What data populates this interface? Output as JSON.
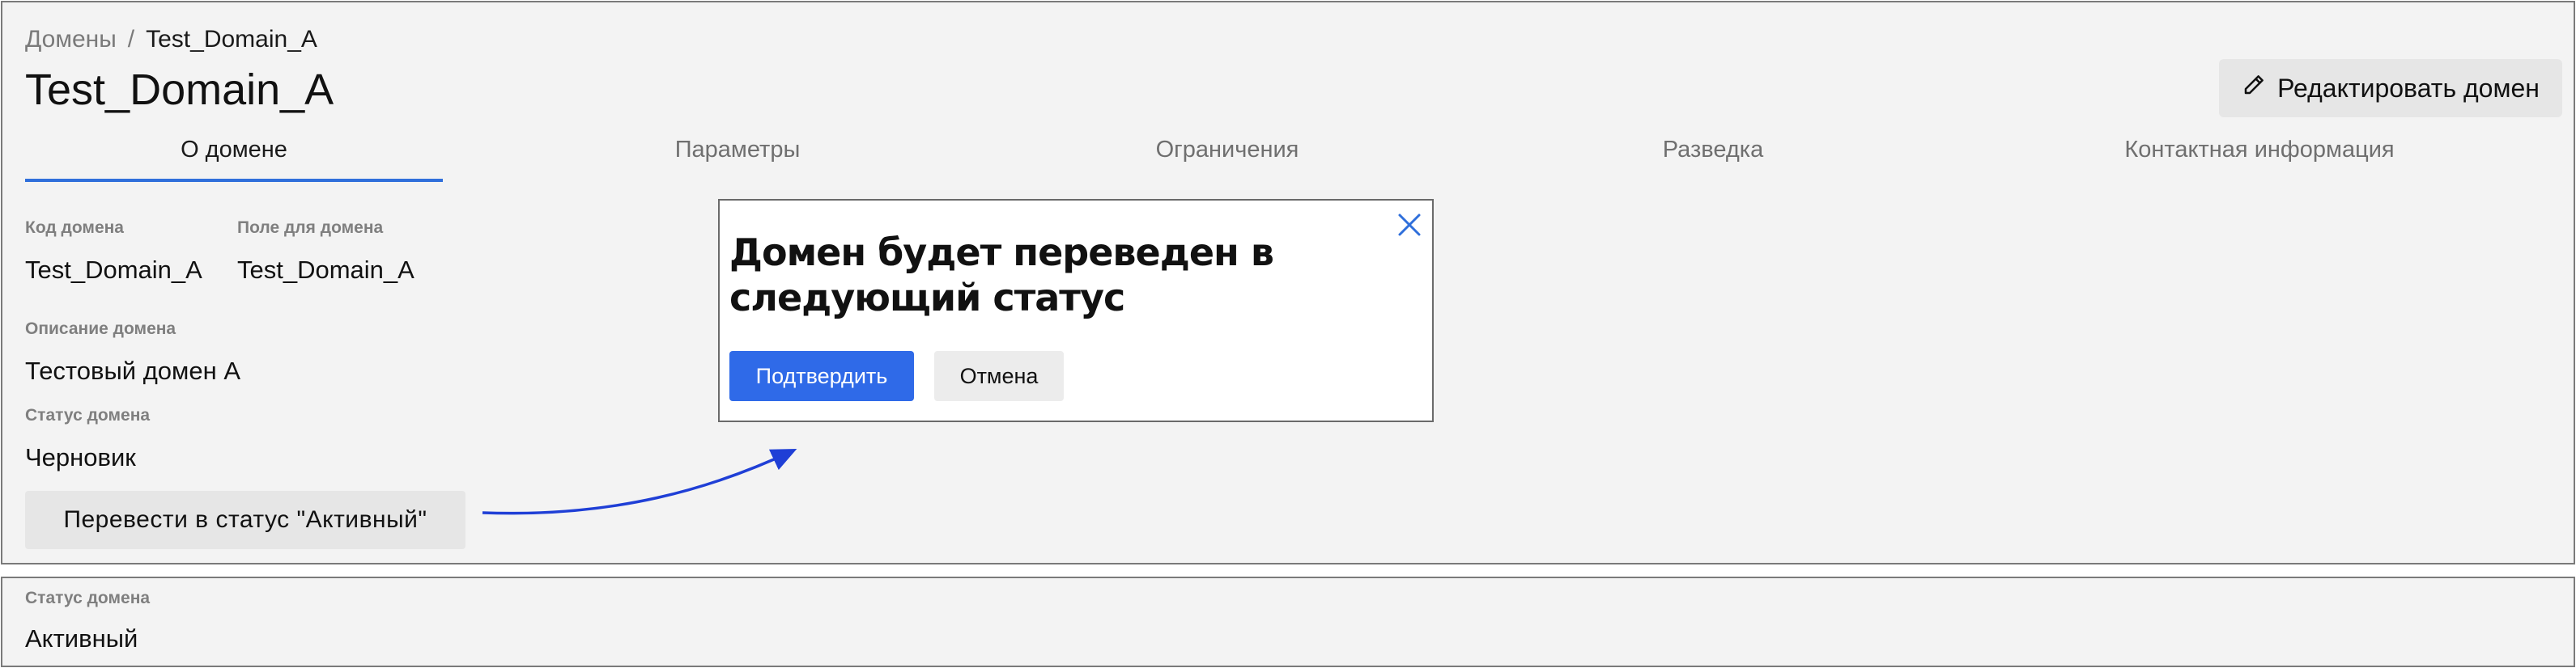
{
  "breadcrumb": {
    "parent": "Домены",
    "separator": "/",
    "current": "Test_Domain_A"
  },
  "page_title": "Test_Domain_A",
  "header": {
    "edit_label": "Редактировать домен",
    "edit_icon": "pencil-icon"
  },
  "tabs": [
    {
      "label": "О домене",
      "active": true
    },
    {
      "label": "Параметры",
      "active": false
    },
    {
      "label": "Ограничения",
      "active": false
    },
    {
      "label": "Разведка",
      "active": false
    },
    {
      "label": "Контактная информация",
      "active": false
    }
  ],
  "fields": {
    "domain_code": {
      "label": "Код домена",
      "value": "Test_Domain_A"
    },
    "domain_field": {
      "label": "Поле для домена",
      "value": "Test_Domain_A"
    },
    "description": {
      "label": "Описание домена",
      "value": "Тестовый домен А"
    },
    "status": {
      "label": "Статус домена",
      "value": "Черновик"
    }
  },
  "transition_button_label": "Перевести в статус \"Активный\"",
  "modal": {
    "title": "Домен будет переведен в следующий статус",
    "confirm_label": "Подтвердить",
    "cancel_label": "Отмена",
    "close_icon": "close-icon"
  },
  "result": {
    "status_label": "Статус домена",
    "status_value": "Активный"
  },
  "colors": {
    "accent": "#2f6fdb",
    "confirm": "#2f6ae8",
    "arrow": "#1f3fd6"
  }
}
